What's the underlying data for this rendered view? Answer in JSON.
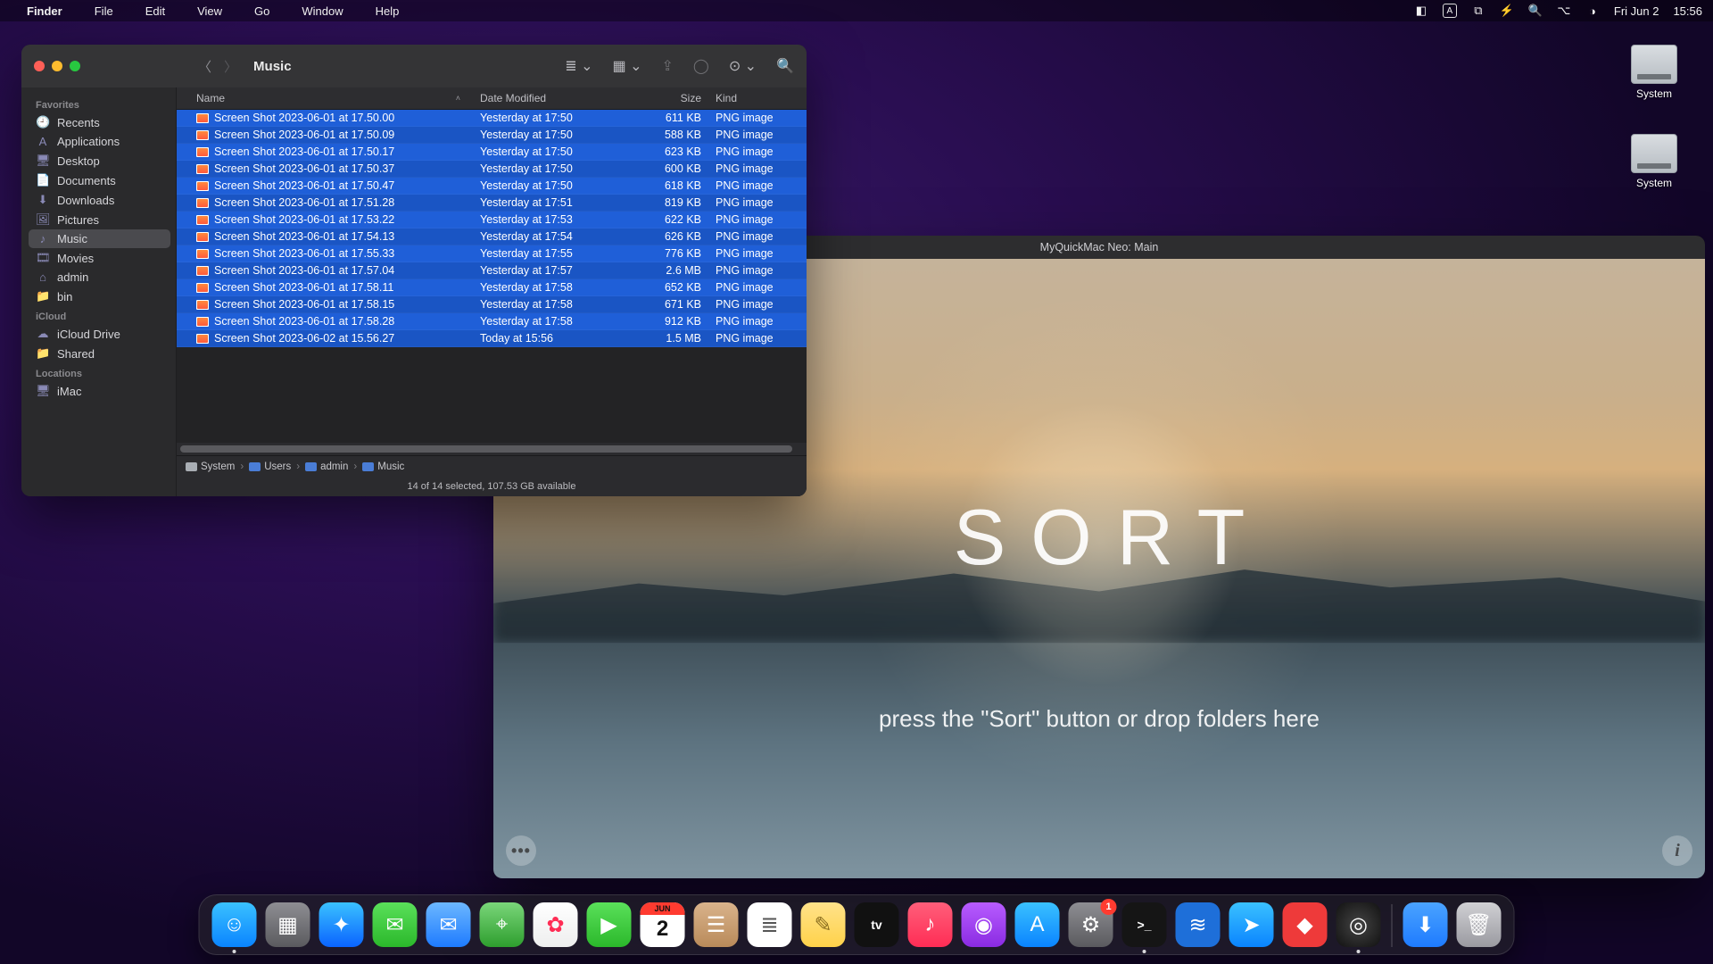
{
  "menubar": {
    "app": "Finder",
    "items": [
      "File",
      "Edit",
      "View",
      "Go",
      "Window",
      "Help"
    ],
    "date": "Fri Jun 2",
    "time": "15:56"
  },
  "desktop": {
    "drives": [
      {
        "label": "System"
      },
      {
        "label": "System"
      }
    ]
  },
  "finder": {
    "title": "Music",
    "sidebar": {
      "sections": [
        {
          "label": "Favorites",
          "items": [
            {
              "icon": "clock-icon",
              "label": "Recents"
            },
            {
              "icon": "app-icon",
              "label": "Applications"
            },
            {
              "icon": "desktop-icon",
              "label": "Desktop"
            },
            {
              "icon": "doc-icon",
              "label": "Documents"
            },
            {
              "icon": "download-icon",
              "label": "Downloads"
            },
            {
              "icon": "pictures-icon",
              "label": "Pictures"
            },
            {
              "icon": "music-icon",
              "label": "Music",
              "selected": true
            },
            {
              "icon": "movies-icon",
              "label": "Movies"
            },
            {
              "icon": "home-icon",
              "label": "admin"
            },
            {
              "icon": "folder-icon",
              "label": "bin"
            }
          ]
        },
        {
          "label": "iCloud",
          "items": [
            {
              "icon": "cloud-icon",
              "label": "iCloud Drive"
            },
            {
              "icon": "shared-icon",
              "label": "Shared"
            }
          ]
        },
        {
          "label": "Locations",
          "items": [
            {
              "icon": "imac-icon",
              "label": "iMac"
            }
          ]
        }
      ]
    },
    "columns": {
      "name": "Name",
      "date": "Date Modified",
      "size": "Size",
      "kind": "Kind"
    },
    "rows": [
      {
        "name": "Screen Shot 2023-06-01 at 17.50.00",
        "date": "Yesterday at 17:50",
        "size": "611 KB",
        "kind": "PNG image"
      },
      {
        "name": "Screen Shot 2023-06-01 at 17.50.09",
        "date": "Yesterday at 17:50",
        "size": "588 KB",
        "kind": "PNG image"
      },
      {
        "name": "Screen Shot 2023-06-01 at 17.50.17",
        "date": "Yesterday at 17:50",
        "size": "623 KB",
        "kind": "PNG image"
      },
      {
        "name": "Screen Shot 2023-06-01 at 17.50.37",
        "date": "Yesterday at 17:50",
        "size": "600 KB",
        "kind": "PNG image"
      },
      {
        "name": "Screen Shot 2023-06-01 at 17.50.47",
        "date": "Yesterday at 17:50",
        "size": "618 KB",
        "kind": "PNG image"
      },
      {
        "name": "Screen Shot 2023-06-01 at 17.51.28",
        "date": "Yesterday at 17:51",
        "size": "819 KB",
        "kind": "PNG image"
      },
      {
        "name": "Screen Shot 2023-06-01 at 17.53.22",
        "date": "Yesterday at 17:53",
        "size": "622 KB",
        "kind": "PNG image"
      },
      {
        "name": "Screen Shot 2023-06-01 at 17.54.13",
        "date": "Yesterday at 17:54",
        "size": "626 KB",
        "kind": "PNG image"
      },
      {
        "name": "Screen Shot 2023-06-01 at 17.55.33",
        "date": "Yesterday at 17:55",
        "size": "776 KB",
        "kind": "PNG image"
      },
      {
        "name": "Screen Shot 2023-06-01 at 17.57.04",
        "date": "Yesterday at 17:57",
        "size": "2.6 MB",
        "kind": "PNG image"
      },
      {
        "name": "Screen Shot 2023-06-01 at 17.58.11",
        "date": "Yesterday at 17:58",
        "size": "652 KB",
        "kind": "PNG image"
      },
      {
        "name": "Screen Shot 2023-06-01 at 17.58.15",
        "date": "Yesterday at 17:58",
        "size": "671 KB",
        "kind": "PNG image"
      },
      {
        "name": "Screen Shot 2023-06-01 at 17.58.28",
        "date": "Yesterday at 17:58",
        "size": "912 KB",
        "kind": "PNG image"
      },
      {
        "name": "Screen Shot 2023-06-02 at 15.56.27",
        "date": "Today at 15:56",
        "size": "1.5 MB",
        "kind": "PNG image"
      }
    ],
    "path": [
      "System",
      "Users",
      "admin",
      "Music"
    ],
    "status": "14 of 14 selected, 107.53 GB available"
  },
  "app": {
    "title": "MyQuickMac Neo: Main",
    "big_label": "SORT",
    "hint": "press the \"Sort\" button or drop folders here"
  },
  "dock": {
    "running_dot": true,
    "items": [
      {
        "name": "finder",
        "bg": "linear-gradient(#3ac1ff,#0a84ff)",
        "glyph": "☺",
        "running": true
      },
      {
        "name": "launchpad",
        "bg": "linear-gradient(#8e8e93,#5a5a5e)",
        "glyph": "▦"
      },
      {
        "name": "safari",
        "bg": "linear-gradient(#3ac1ff,#0a63ff)",
        "glyph": "✦"
      },
      {
        "name": "messages",
        "bg": "linear-gradient(#5ae05a,#2bb82b)",
        "glyph": "✉"
      },
      {
        "name": "mail",
        "bg": "linear-gradient(#6cb7ff,#1e7bff)",
        "glyph": "✉"
      },
      {
        "name": "maps",
        "bg": "linear-gradient(#7ad67a,#2e9e2e)",
        "glyph": "⌖"
      },
      {
        "name": "photos",
        "bg": "linear-gradient(#ffffff,#eeeeee)",
        "glyph": "✿",
        "fg": "#ff2d55"
      },
      {
        "name": "facetime",
        "bg": "linear-gradient(#5ae05a,#2bb82b)",
        "glyph": "▶"
      },
      {
        "name": "calendar",
        "bg": "#ffffff",
        "glyph": "2",
        "fg": "#111",
        "strip": "JUN"
      },
      {
        "name": "contacts",
        "bg": "linear-gradient(#d9b38c,#b98a5a)",
        "glyph": "☰"
      },
      {
        "name": "reminders",
        "bg": "#ffffff",
        "glyph": "≣",
        "fg": "#555"
      },
      {
        "name": "notes",
        "bg": "linear-gradient(#ffe28a,#ffd24a)",
        "glyph": "✎",
        "fg": "#8a6d1f"
      },
      {
        "name": "tv",
        "bg": "#111111",
        "glyph": "tv",
        "text": true
      },
      {
        "name": "music",
        "bg": "linear-gradient(#ff5e7a,#ff2d55)",
        "glyph": "♪"
      },
      {
        "name": "podcasts",
        "bg": "linear-gradient(#b85cff,#8a2be2)",
        "glyph": "◉"
      },
      {
        "name": "appstore",
        "bg": "linear-gradient(#3ac1ff,#0a84ff)",
        "glyph": "A"
      },
      {
        "name": "settings",
        "bg": "linear-gradient(#8e8e93,#5a5a5e)",
        "glyph": "⚙",
        "badge": "1"
      },
      {
        "name": "terminal",
        "bg": "#151515",
        "glyph": ">_",
        "text": true,
        "running": true
      },
      {
        "name": "vscode",
        "bg": "#1e6fd9",
        "glyph": "≋"
      },
      {
        "name": "telegram",
        "bg": "linear-gradient(#3ac1ff,#0a84ff)",
        "glyph": "➤"
      },
      {
        "name": "anydesk",
        "bg": "#ee3a3a",
        "glyph": "◆"
      },
      {
        "name": "myquickmac",
        "bg": "radial-gradient(circle,#444,#111)",
        "glyph": "◎",
        "running": true
      }
    ],
    "right": [
      {
        "name": "downloads-stack",
        "bg": "linear-gradient(#4aa3ff,#1e7bff)",
        "glyph": "⬇"
      },
      {
        "name": "trash",
        "bg": "linear-gradient(#d0d0d4,#9a9aa0)",
        "glyph": "🗑"
      }
    ]
  },
  "colors": {
    "selection": "#1f5fd8"
  }
}
